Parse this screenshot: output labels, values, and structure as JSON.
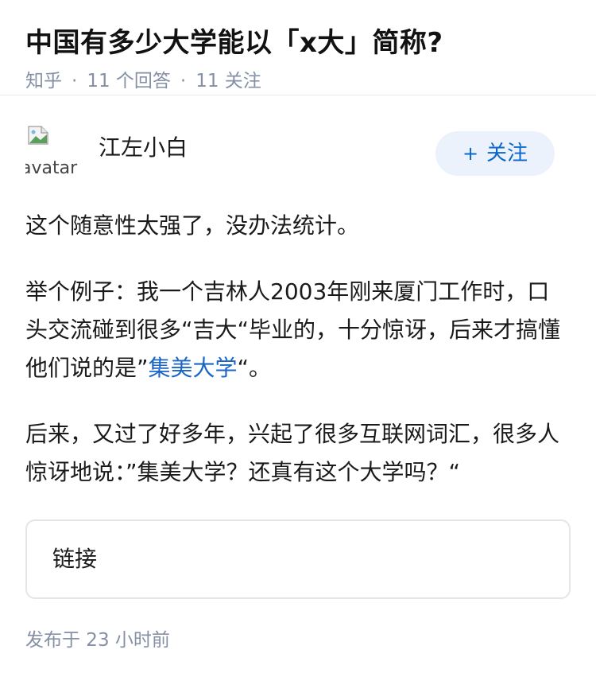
{
  "question": {
    "title": "中国有多少大学能以「x大」简称?",
    "source": "知乎",
    "answers": "11 个回答",
    "followers": "11 关注",
    "separator": "·"
  },
  "author": {
    "avatar_alt": "avatar",
    "name": "江左小白",
    "follow_icon": "+",
    "follow_label": "关注"
  },
  "answer": {
    "p1": "这个随意性太强了，没办法统计。",
    "p2_text": "举个例子：我一个吉林人2003年刚来厦门工作时，口头交流碰到很多“吉大“毕业的，十分惊讶，后来才搞懂他们说的是”",
    "p2_link": "集美大学",
    "p2_end": "“。",
    "p3": "后来，又过了好多年，兴起了很多互联网词汇，很多人惊讶地说：”集美大学？还真有这个大学吗？“"
  },
  "link_card": {
    "label": "链接"
  },
  "footer": {
    "published": "发布于  23 小时前"
  },
  "colors": {
    "link": "#1a66c7",
    "meta": "#8590a6",
    "follow_bg": "#ebf2fb",
    "follow_text": "#0b67cc"
  }
}
